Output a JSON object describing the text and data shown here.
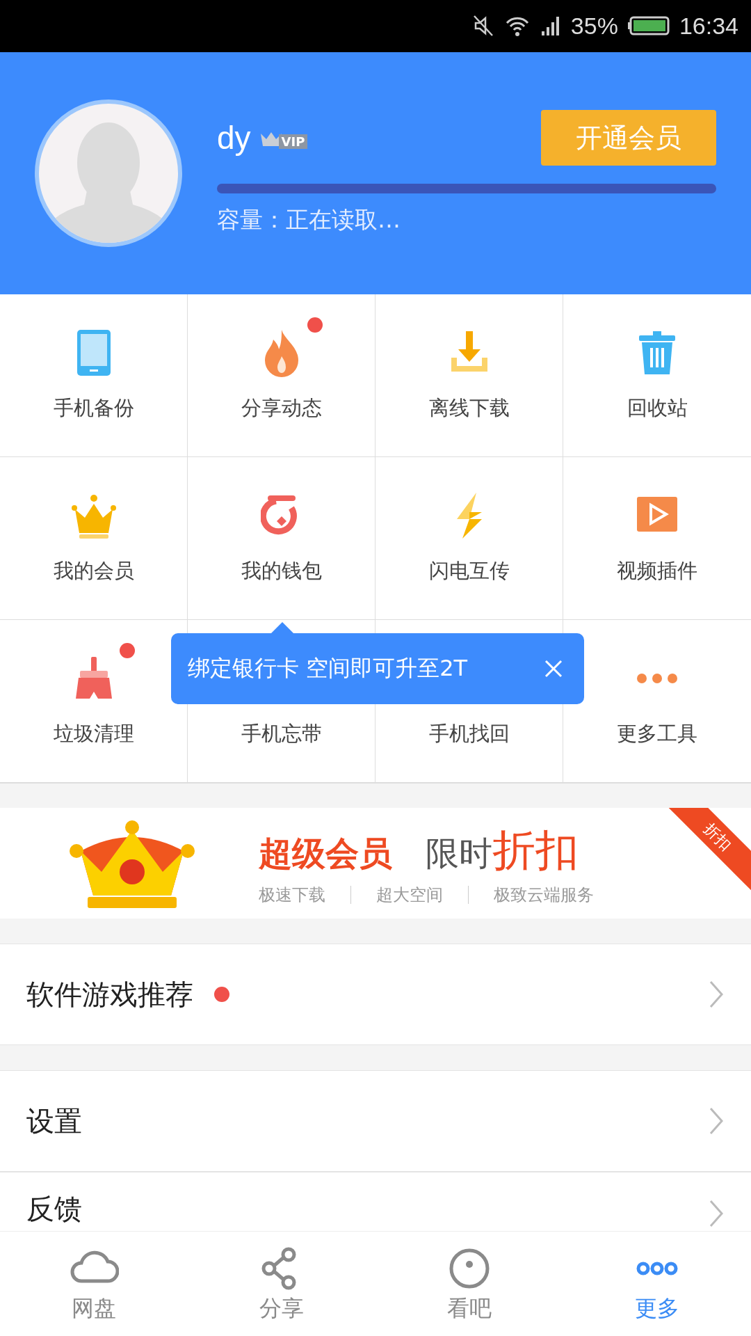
{
  "status_bar": {
    "battery": "35%",
    "time": "16:34"
  },
  "profile": {
    "name": "dy",
    "badge": "VIP",
    "button": "开通会员",
    "storage": {
      "level": 0
    },
    "capacity": "容量：正在读取…"
  },
  "tools": [
    {
      "label": "手机备份",
      "dot": false
    },
    {
      "label": "分享动态",
      "dot": true
    },
    {
      "label": "离线下载",
      "dot": false
    },
    {
      "label": "回收站",
      "dot": false
    },
    {
      "label": "我的会员",
      "dot": false
    },
    {
      "label": "我的钱包",
      "dot": false
    },
    {
      "label": "闪电互传",
      "dot": false
    },
    {
      "label": "视频插件",
      "dot": false
    },
    {
      "label": "垃圾清理",
      "dot": true
    },
    {
      "label": "手机忘带",
      "dot": false
    },
    {
      "label": "手机找回",
      "dot": false
    },
    {
      "label": "更多工具",
      "dot": false
    }
  ],
  "tooltip": {
    "text": "绑定银行卡 空间即可升至2T"
  },
  "banner": {
    "title": "超级会员",
    "subtitle": "限时",
    "highlight": "折扣",
    "features": [
      "极速下载",
      "超大空间",
      "极致云端服务"
    ],
    "ribbon": "折扣"
  },
  "menu": [
    {
      "label": "软件游戏推荐",
      "dot": true
    },
    {
      "label": "设置",
      "dot": false
    },
    {
      "label": "反馈",
      "dot": false
    }
  ],
  "nav": [
    {
      "label": "网盘",
      "selected": false
    },
    {
      "label": "分享",
      "selected": false
    },
    {
      "label": "看吧",
      "selected": false
    },
    {
      "label": "更多",
      "selected": true
    }
  ]
}
